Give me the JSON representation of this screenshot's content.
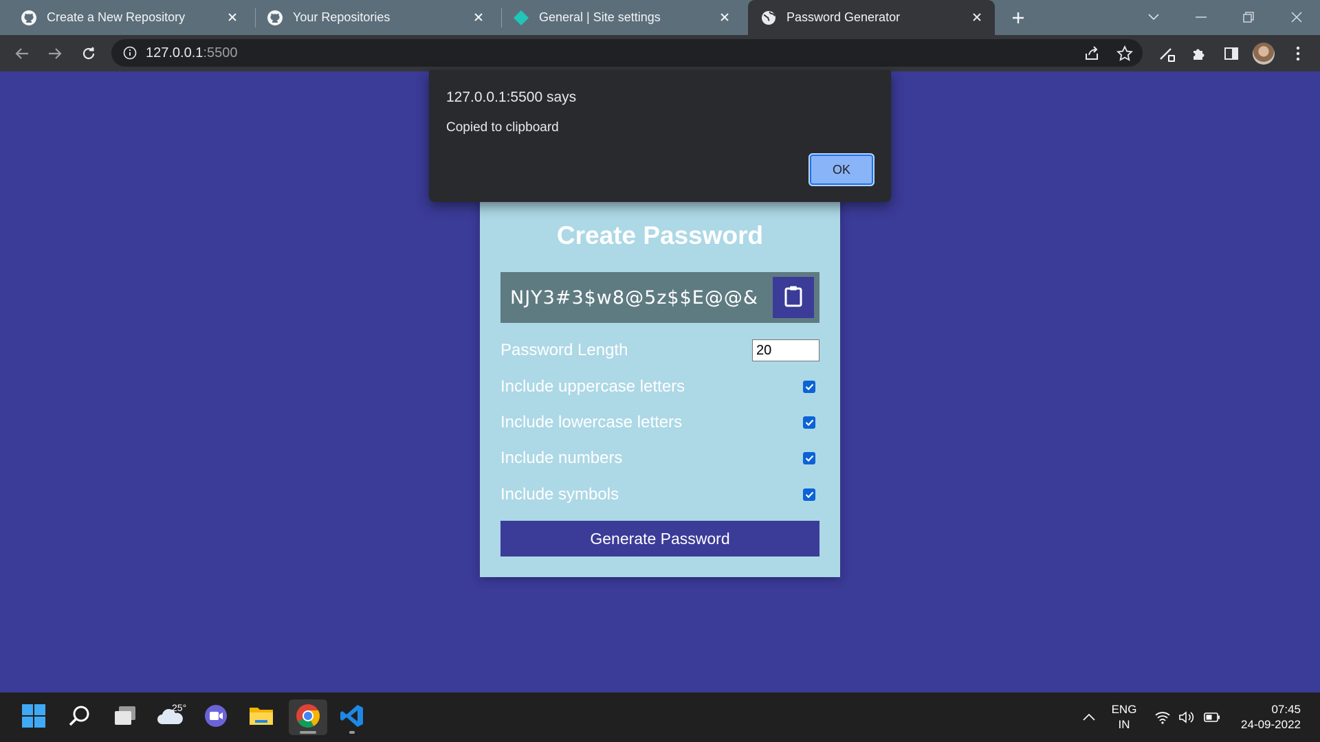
{
  "browser": {
    "tabs": [
      {
        "title": "Create a New Repository",
        "icon": "github-icon",
        "active": false
      },
      {
        "title": "Your Repositories",
        "icon": "github-icon",
        "active": false
      },
      {
        "title": "General | Site settings",
        "icon": "netlify-icon",
        "active": false
      },
      {
        "title": "Password Generator",
        "icon": "globe-icon",
        "active": true
      }
    ],
    "url_host": "127.0.0.1",
    "url_port": ":5500"
  },
  "alert": {
    "title": "127.0.0.1:5500 says",
    "message": "Copied to clipboard",
    "ok_label": "OK"
  },
  "generator": {
    "title": "Create Password",
    "password": "NJY3#3$w8@5z$$E@@&",
    "length_label": "Password Length",
    "length_value": "20",
    "options": [
      {
        "label": "Include uppercase letters",
        "checked": true
      },
      {
        "label": "Include lowercase letters",
        "checked": true
      },
      {
        "label": "Include numbers",
        "checked": true
      },
      {
        "label": "Include symbols",
        "checked": true
      }
    ],
    "generate_label": "Generate Password"
  },
  "taskbar": {
    "weather_temp": "25°",
    "lang_line1": "ENG",
    "lang_line2": "IN",
    "time": "07:45",
    "date": "24-09-2022"
  },
  "colors": {
    "page_bg": "#3b3b98",
    "card_bg": "#add8e6",
    "result_bg": "#5f7b82",
    "accent": "#3b3b98",
    "checkbox": "#0b63d6"
  }
}
